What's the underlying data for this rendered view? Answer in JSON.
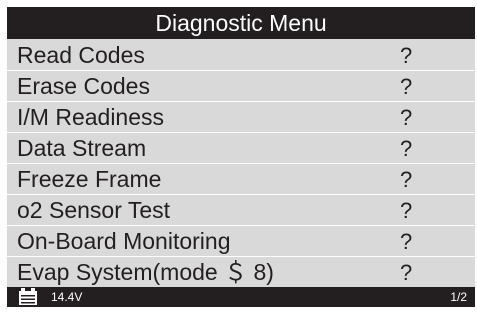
{
  "screen": {
    "title": "Diagnostic Menu"
  },
  "menu": {
    "items": [
      {
        "label": "Read Codes",
        "status": "?"
      },
      {
        "label": "Erase Codes",
        "status": "?"
      },
      {
        "label": "I/M Readiness",
        "status": "?"
      },
      {
        "label": "Data Stream",
        "status": "?"
      },
      {
        "label": "Freeze Frame",
        "status": "?"
      },
      {
        "label": "o2 Sensor Test",
        "status": "?"
      },
      {
        "label": "On-Board Monitoring",
        "status": "?"
      },
      {
        "label": "Evap System(mode ＄ 8)",
        "status": "?"
      }
    ]
  },
  "status_bar": {
    "battery_icon": "battery-icon",
    "voltage": "14.4V",
    "page": "1/2"
  },
  "colors": {
    "background": "#d9d9d9",
    "bar": "#231f20",
    "text": "#231f20",
    "bar_text": "#ffffff"
  }
}
